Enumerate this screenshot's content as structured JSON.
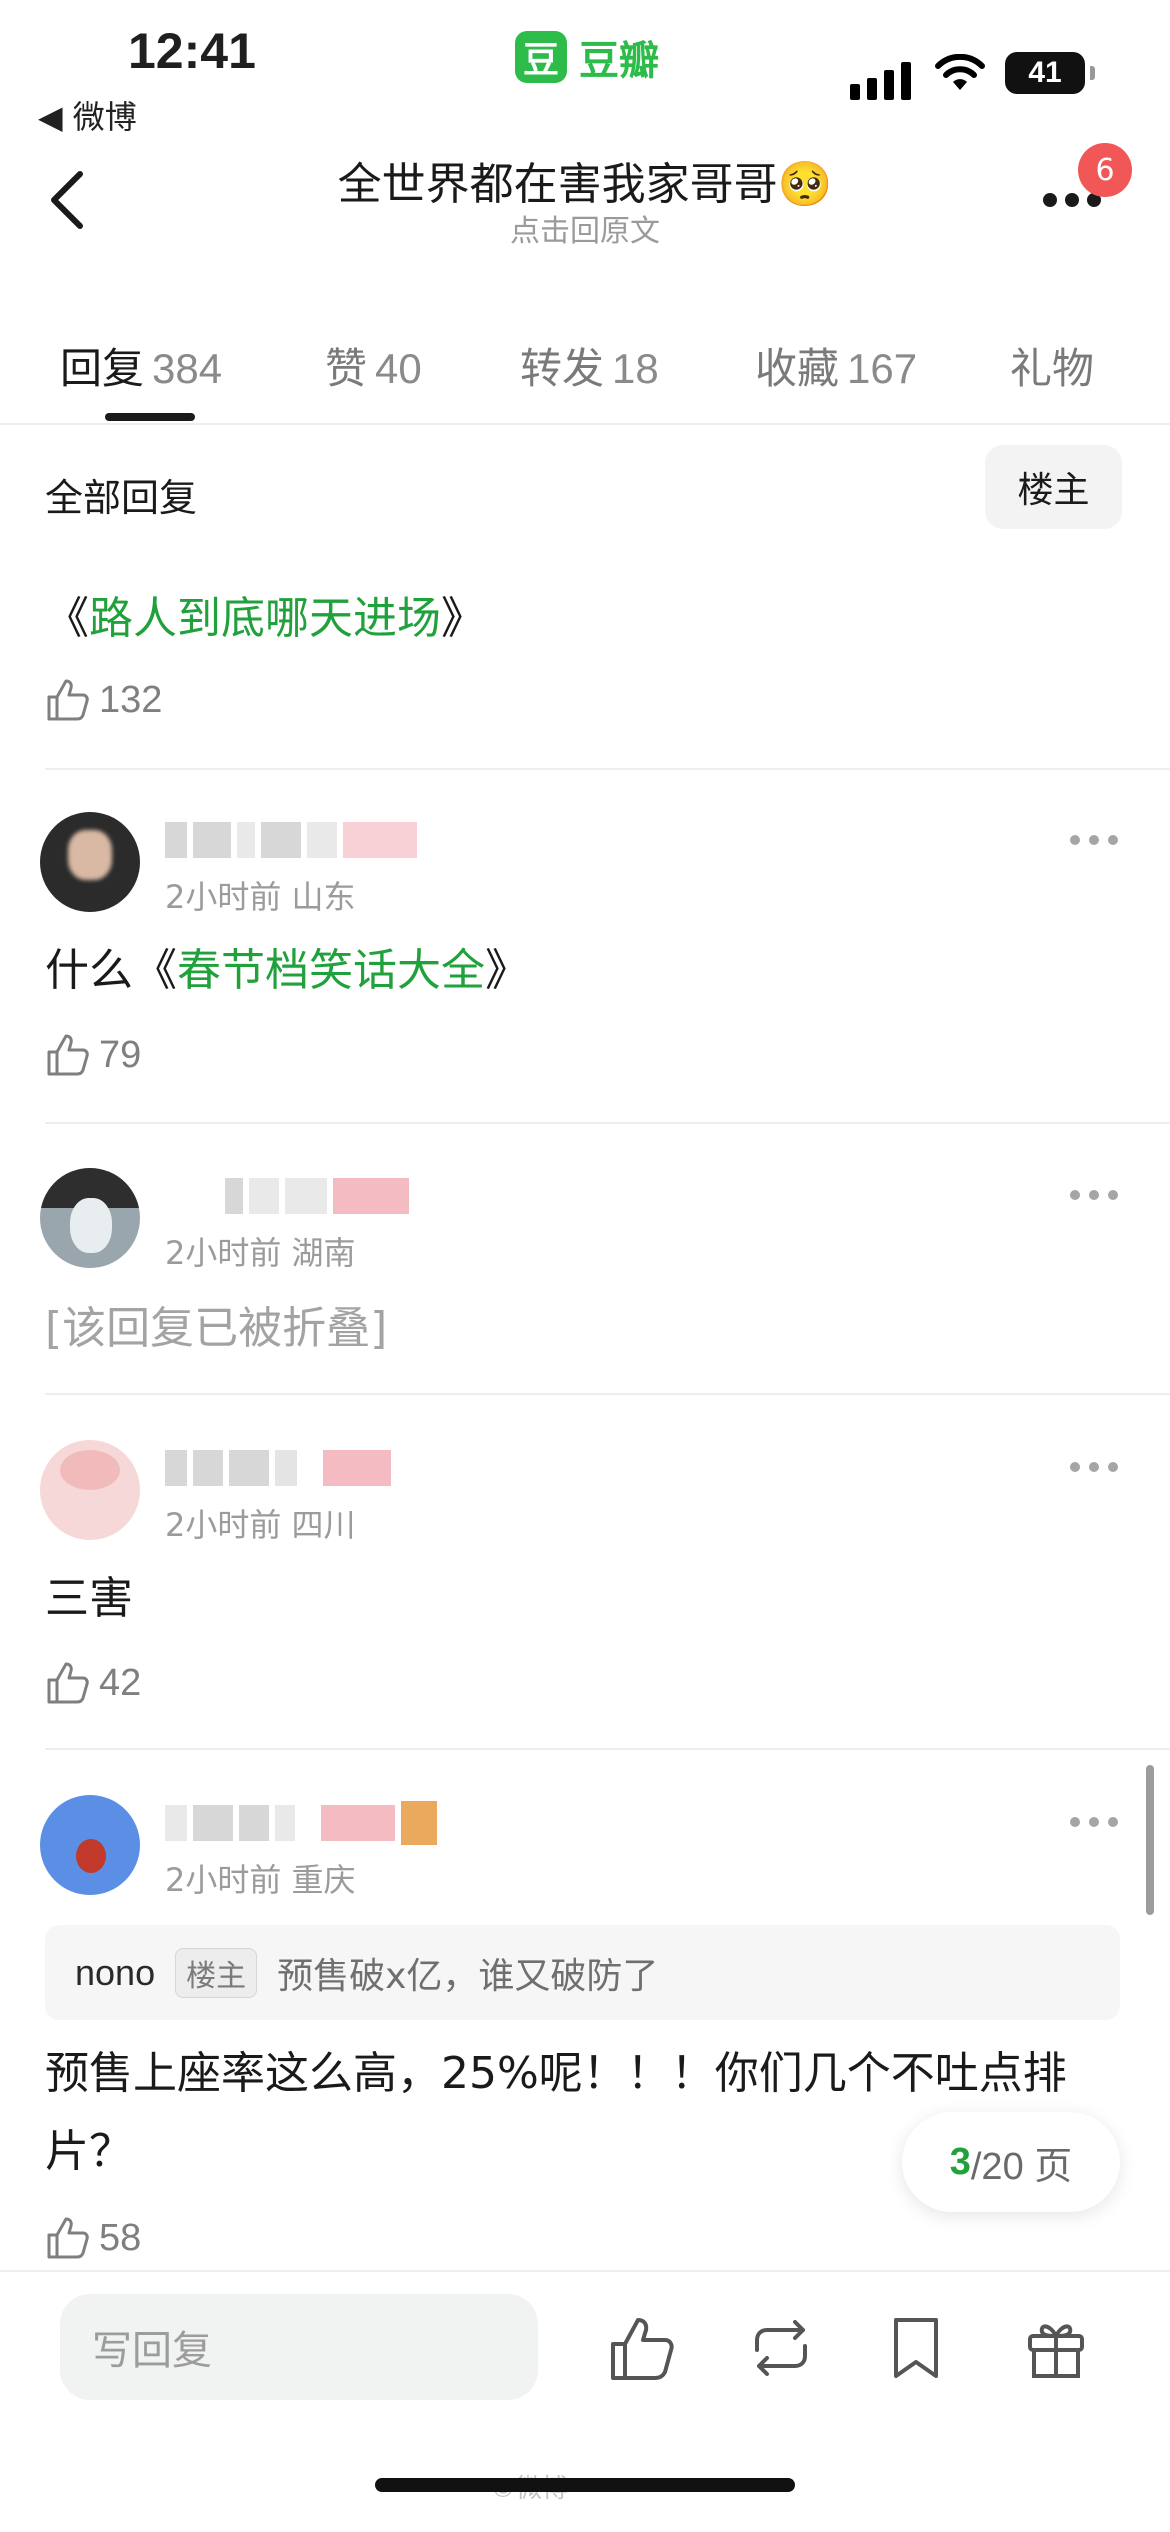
{
  "status_bar": {
    "time": "12:41",
    "back_app": "◀ 微博",
    "app_logo": "豆",
    "app_name": "豆瓣",
    "battery": "41"
  },
  "header": {
    "title": "全世界都在害我家哥哥🥺",
    "subtitle": "点击回原文",
    "badge_count": "6"
  },
  "tabs": [
    {
      "label": "回复",
      "count": "384",
      "active": true
    },
    {
      "label": "赞",
      "count": "40"
    },
    {
      "label": "转发",
      "count": "18"
    },
    {
      "label": "收藏",
      "count": "167"
    },
    {
      "label": "礼物",
      "count": ""
    }
  ],
  "filter": {
    "label": "全部回复",
    "button": "楼主"
  },
  "comments": [
    {
      "pre": "《",
      "link": "路人到底哪天进场",
      "post": "》",
      "likes": "132"
    },
    {
      "meta": "2小时前 山东",
      "pre": "什么《",
      "link": "春节档笑话大全",
      "post": "》",
      "likes": "79"
    },
    {
      "meta": "2小时前 湖南",
      "text": "[该回复已被折叠]"
    },
    {
      "meta": "2小时前 四川",
      "text": "三害",
      "likes": "42"
    },
    {
      "meta": "2小时前 重庆",
      "quote_user": "nono",
      "quote_tag": "楼主",
      "quote_text": "预售破x亿，谁又破防了",
      "line1": "预售上座率这么高，25%呢！！！你们几个不吐点排",
      "line2": "片？",
      "likes": "58"
    }
  ],
  "pagination": {
    "current": "3",
    "total": "/20 页"
  },
  "bottom_bar": {
    "reply_placeholder": "写回复"
  },
  "watermark": "©微博"
}
